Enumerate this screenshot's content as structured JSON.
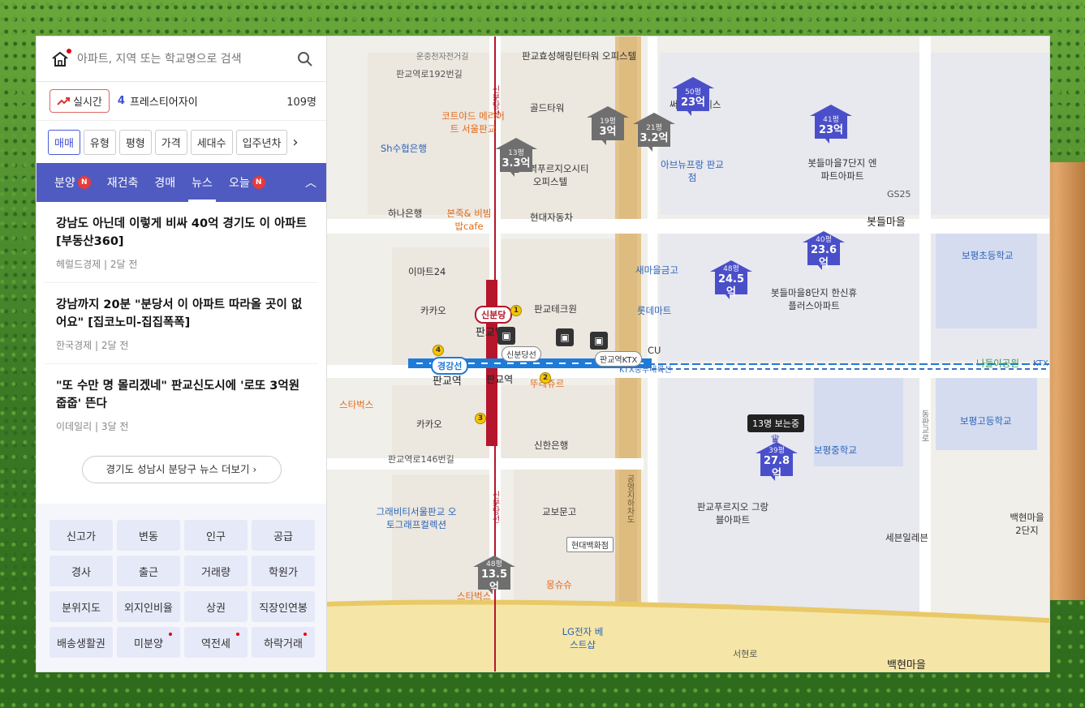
{
  "search": {
    "placeholder": "아파트, 지역 또는 학교명으로 검색"
  },
  "realtime": {
    "button": "실시간",
    "rank": "4",
    "name": "프레스티어자이",
    "count": "109명"
  },
  "filters": [
    "매매",
    "유형",
    "평형",
    "가격",
    "세대수",
    "입주년차"
  ],
  "tabs": [
    {
      "label": "분양",
      "badge": "N"
    },
    {
      "label": "재건축",
      "badge": ""
    },
    {
      "label": "경매",
      "badge": ""
    },
    {
      "label": "뉴스",
      "badge": ""
    },
    {
      "label": "오늘",
      "badge": "N"
    }
  ],
  "news": [
    {
      "title": "강남도 아닌데 이렇게 비싸 40억 경기도 이 아파트 [부동산360]",
      "source": "헤럴드경제",
      "time": "2달 전"
    },
    {
      "title": "강남까지 20분 \"분당서 이 아파트 따라올 곳이 없어요\" [집코노미-집집폭폭]",
      "source": "한국경제",
      "time": "2달 전"
    },
    {
      "title": "\"또 수만 명 몰리겠네\" 판교신도시에 '로또 3억원 줍줍' 뜬다",
      "source": "이데일리",
      "time": "3달 전"
    }
  ],
  "more": "경기도 성남시 분당구 뉴스 더보기",
  "quick": [
    {
      "label": "신고가",
      "dot": false
    },
    {
      "label": "변동",
      "dot": false
    },
    {
      "label": "인구",
      "dot": false
    },
    {
      "label": "공급",
      "dot": false
    },
    {
      "label": "경사",
      "dot": false
    },
    {
      "label": "출근",
      "dot": false
    },
    {
      "label": "거래량",
      "dot": false
    },
    {
      "label": "학원가",
      "dot": false
    },
    {
      "label": "분위지도",
      "dot": false
    },
    {
      "label": "외지인비율",
      "dot": false
    },
    {
      "label": "상권",
      "dot": false
    },
    {
      "label": "직장인연봉",
      "dot": false
    },
    {
      "label": "배송생활권",
      "dot": false
    },
    {
      "label": "미분양",
      "dot": true
    },
    {
      "label": "역전세",
      "dot": true
    },
    {
      "label": "하락거래",
      "dot": true
    }
  ],
  "map": {
    "prices": [
      {
        "size": "50평",
        "value": "23억",
        "color": "blue"
      },
      {
        "size": "41평",
        "value": "23억",
        "color": "blue"
      },
      {
        "size": "19평",
        "value": "3억",
        "color": "grey"
      },
      {
        "size": "21평",
        "value": "3.2억",
        "color": "grey"
      },
      {
        "size": "13평",
        "value": "3.3억",
        "color": "grey"
      },
      {
        "size": "40평",
        "value": "23.6억",
        "color": "blue"
      },
      {
        "size": "48평",
        "value": "24.5억",
        "color": "blue"
      },
      {
        "size": "39평",
        "value": "27.8억",
        "color": "blue"
      },
      {
        "size": "48평",
        "value": "13.5억",
        "color": "grey"
      }
    ],
    "viewing": "13명 보는중",
    "labels": {
      "l1": "판교효성해링턴타워 오피스텔",
      "l2": "판교역로192번길",
      "l3": "운중천자전거길",
      "l4": "코트야드 메리어트 서울판교",
      "l5": "골드타워",
      "l6": "Sh수협은행",
      "l7": "판교역푸르지오시티 오피스텔",
      "l8": "하나은행",
      "l9": "본죽& 비빔밥cafe",
      "l10": "현대자동차",
      "l11": "써밋플레이스",
      "l12": "아브뉴프랑 판교점",
      "l13": "봇들마을7단지 엔파트아파트",
      "l14": "GS25",
      "l15": "봇들마을",
      "l16": "이마트24",
      "l17": "카카오",
      "l18": "신분당",
      "l19": "판교역",
      "l20": "판교테크원",
      "l21": "새마을금고",
      "l22": "롯데마트",
      "l23": "봇들마을8단지 한신휴플러스아파트",
      "l24": "보평초등학교",
      "l25": "경강선",
      "l26": "신분당선",
      "l27": "판교역KTX",
      "l28": "KTX중부내륙선",
      "l29": "나들이공원",
      "l30": "KTX",
      "l31": "스타벅스",
      "l32": "카카오",
      "l33": "뚜레쥬르",
      "l34": "신한은행",
      "l35": "보평고등학교",
      "l36": "보평중학교",
      "l37": "판교역로146번길",
      "l38": "그래비티서울판교 오토그래프컬렉션",
      "l39": "교보문고",
      "l40": "현대백화점",
      "l41": "판교푸르지오 그랑블아파트",
      "l42": "세븐일레븐",
      "l43": "백현마을 2단지",
      "l44": "몽슈슈",
      "l45": "스타벅스",
      "l46": "LG전자 베스트샵",
      "l47": "서현로",
      "l48": "백현마을",
      "l49": "CU",
      "l50": "판교역",
      "l51": "동판교로",
      "l52": "공영지하차도",
      "l53": "신분당선",
      "l54": "신분당선",
      "l55": "판교역"
    }
  },
  "colors": {
    "accent": "#4f5bc0",
    "price_blue": "#4a4fc9",
    "price_grey": "#6f6f6f",
    "line_blue": "#1e7bd8",
    "line_red": "#b5162b"
  }
}
